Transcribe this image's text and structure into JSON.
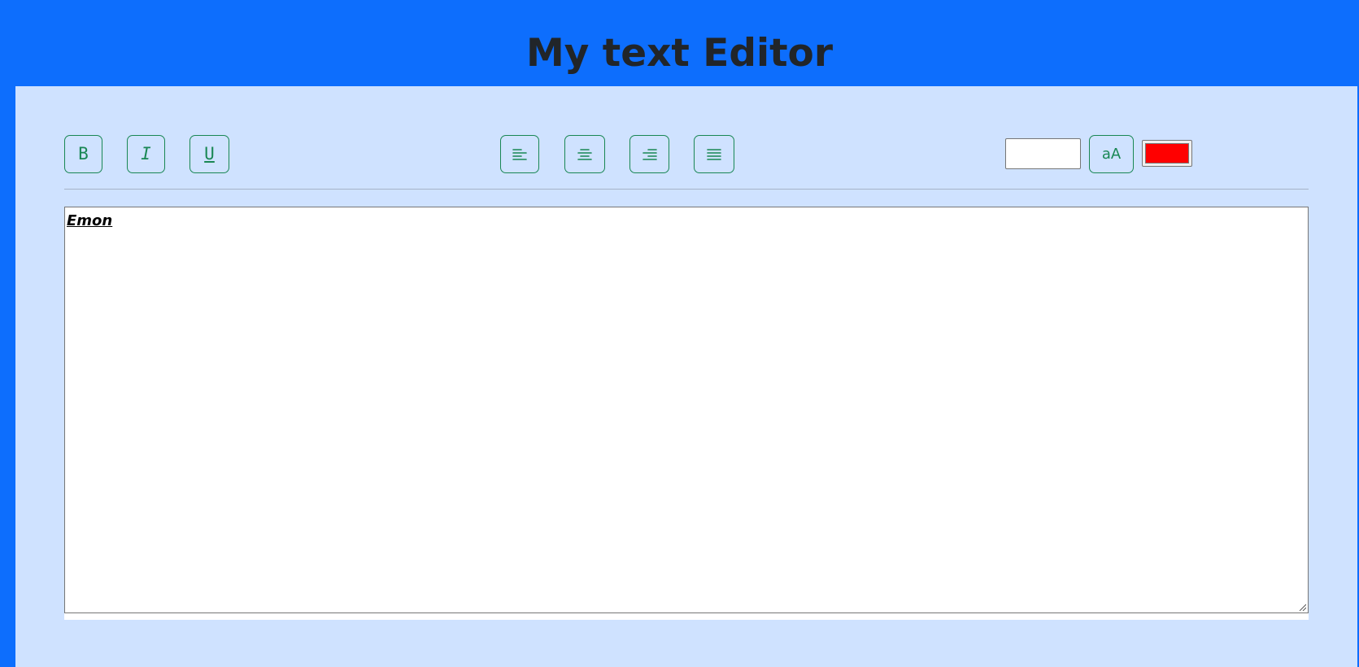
{
  "app": {
    "title": "My text Editor"
  },
  "toolbar": {
    "bold_label": "B",
    "italic_label": "I",
    "underline_label": "U",
    "align_left_icon": "align-left-icon",
    "align_center_icon": "align-center-icon",
    "align_right_icon": "align-right-icon",
    "align_justify_icon": "align-justify-icon",
    "font_size_value": "",
    "case_toggle_label": "aA",
    "text_color": "#ff0000"
  },
  "editor": {
    "content": "Emon"
  },
  "colors": {
    "header_bg": "#0d6efd",
    "panel_bg": "#cfe2ff",
    "button_accent": "#198754",
    "title_text": "#212529"
  }
}
